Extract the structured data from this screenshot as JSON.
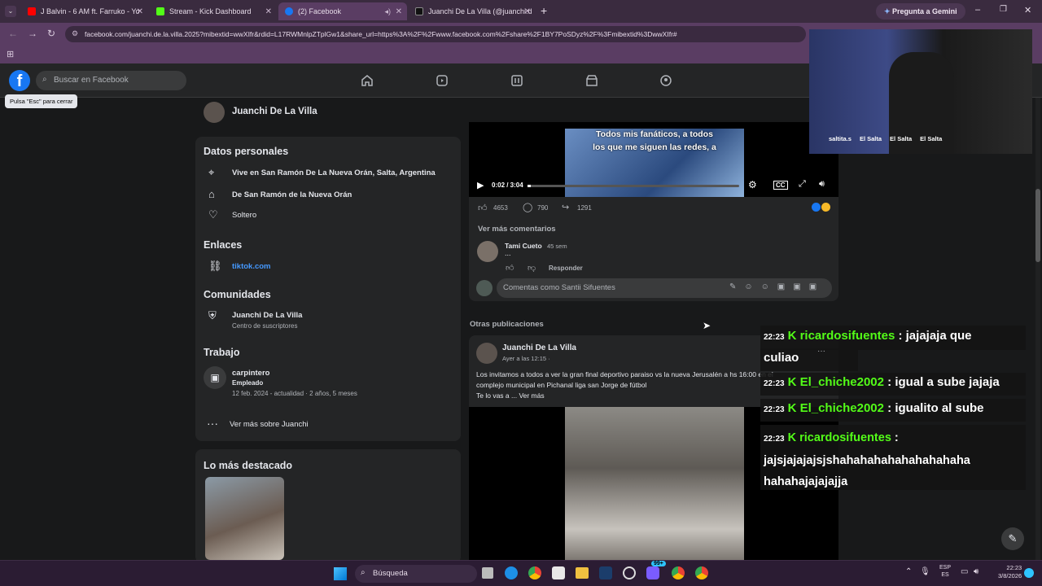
{
  "browser": {
    "tabs": [
      {
        "label": "J Balvin - 6 AM ft. Farruko - Yo",
        "color": "#ff0000"
      },
      {
        "label": "Stream - Kick Dashboard",
        "color": "#53fc18"
      },
      {
        "label": "(2) Facebook",
        "color": "#1877f2"
      },
      {
        "label": "Juanchi De La Villa (@juanchi.d",
        "color": "#111111"
      }
    ],
    "gemini_label": "Pregunta a Gemini",
    "url": "facebook.com/juanchi.de.la.villa.2025?mibextid=wwXIfr&rdid=L17RWMnlpZTplGw1&share_url=https%3A%2F%2Fwww.facebook.com%2Fshare%2F1BY7PoSDyz%2F%3Fmibextid%3DwwXIfr#"
  },
  "fb": {
    "search_placeholder": "Buscar en Facebook",
    "esc_tooltip": "Pulsa \"Esc\" para cerrar",
    "profile_name": "Juanchi De La Villa"
  },
  "about": {
    "personal_title": "Datos personales",
    "lives_in": "Vive en San Ramón De La Nueva Orán, Salta, Argentina",
    "from": "De San Ramón de la Nueva Orán",
    "relationship": "Soltero",
    "links_title": "Enlaces",
    "link": "tiktok.com",
    "communities_title": "Comunidades",
    "community_name": "Juanchi De La Villa",
    "community_sub": "Centro de suscriptores",
    "work_title": "Trabajo",
    "job_title": "carpintero",
    "job_status": "Empleado",
    "job_dates": "12 feb. 2024 - actualidad · 2 años, 5 meses",
    "see_more": "Ver más sobre Juanchi",
    "highlights_title": "Lo más destacado"
  },
  "video1": {
    "caption_line1": "Todos mis fanáticos, a todos",
    "caption_line2": "los que me siguen las redes, a",
    "time": "0:02 / 3:04",
    "likes": "4653",
    "comments": "790",
    "shares": "1291",
    "see_more_comments": "Ver más comentarios",
    "commenter": "Tami Cueto",
    "comment_time": "45 sem",
    "comment_text": "...",
    "reply": "Responder",
    "comment_as": "Comentas como Santii Sifuentes"
  },
  "post2": {
    "section_label": "Otras publicaciones",
    "author": "Juanchi De La Villa",
    "time": "Ayer a las 12:15 ·",
    "text_line1": "Los invitamos a todos a ver la gran final deportivo paraiso vs la nueva Jerusalén a hs 16:00 en el",
    "text_line2": "complejo municipal en Pichanal liga san Jorge de fútbol",
    "text_line3": "Te lo vas a ... Ver más"
  },
  "webcam": {
    "handles": [
      "saltita.s",
      "El Salta",
      "El Salta",
      "El Salta"
    ]
  },
  "chat": [
    {
      "time": "22:23",
      "user": "ricardosifuentes",
      "msg": "jajajaja que"
    },
    {
      "time": "",
      "user": "",
      "msg": "culiao"
    },
    {
      "time": "22:23",
      "user": "El_chiche2002",
      "msg": "igual a sube jajaja"
    },
    {
      "time": "22:23",
      "user": "El_chiche2002",
      "msg": "igualito al sube"
    },
    {
      "time": "22:23",
      "user": "ricardosifuentes",
      "msg": ""
    },
    {
      "time": "",
      "user": "",
      "msg": "jajsjajajajsjshahahahahahahahahaha"
    },
    {
      "time": "",
      "user": "",
      "msg": "hahahajajajajja"
    }
  ],
  "taskbar": {
    "search": "Búsqueda",
    "lang1": "ESP",
    "lang2": "ES",
    "clock_time": "22:23",
    "clock_date": "3/8/2026",
    "badge": "99+"
  },
  "colors": {
    "kick_green": "#53fc18",
    "fb_blue": "#1877f2",
    "link_blue": "#4599ff"
  }
}
